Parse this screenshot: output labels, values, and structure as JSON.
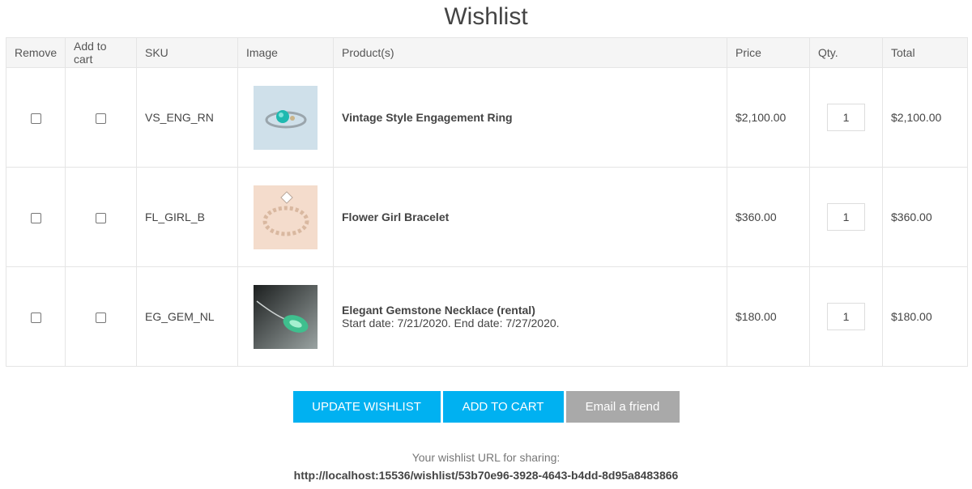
{
  "page": {
    "title": "Wishlist"
  },
  "table": {
    "headers": {
      "remove": "Remove",
      "add_to_cart": "Add to cart",
      "sku": "SKU",
      "image": "Image",
      "products": "Product(s)",
      "price": "Price",
      "qty": "Qty.",
      "total": "Total"
    },
    "rows": [
      {
        "sku": "VS_ENG_RN",
        "name": "Vintage Style Engagement Ring",
        "detail": "",
        "price": "$2,100.00",
        "qty": "1",
        "total": "$2,100.00",
        "remove_checked": false,
        "add_checked": false,
        "image_icon": "ring-thumbnail-icon"
      },
      {
        "sku": "FL_GIRL_B",
        "name": "Flower Girl Bracelet",
        "detail": "",
        "price": "$360.00",
        "qty": "1",
        "total": "$360.00",
        "remove_checked": false,
        "add_checked": false,
        "image_icon": "bracelet-thumbnail-icon"
      },
      {
        "sku": "EG_GEM_NL",
        "name": "Elegant Gemstone Necklace (rental)",
        "detail": "Start date: 7/21/2020. End date: 7/27/2020.",
        "price": "$180.00",
        "qty": "1",
        "total": "$180.00",
        "remove_checked": false,
        "add_checked": false,
        "image_icon": "necklace-thumbnail-icon"
      }
    ]
  },
  "buttons": {
    "update_wishlist": "UPDATE WISHLIST",
    "add_to_cart": "ADD TO CART",
    "email_friend": "Email a friend"
  },
  "share": {
    "label": "Your wishlist URL for sharing:",
    "url": "http://localhost:15536/wishlist/53b70e96-3928-4643-b4dd-8d95a8483866"
  },
  "colors": {
    "accent": "#00b1f1",
    "secondary_button": "#a9a9a9"
  }
}
